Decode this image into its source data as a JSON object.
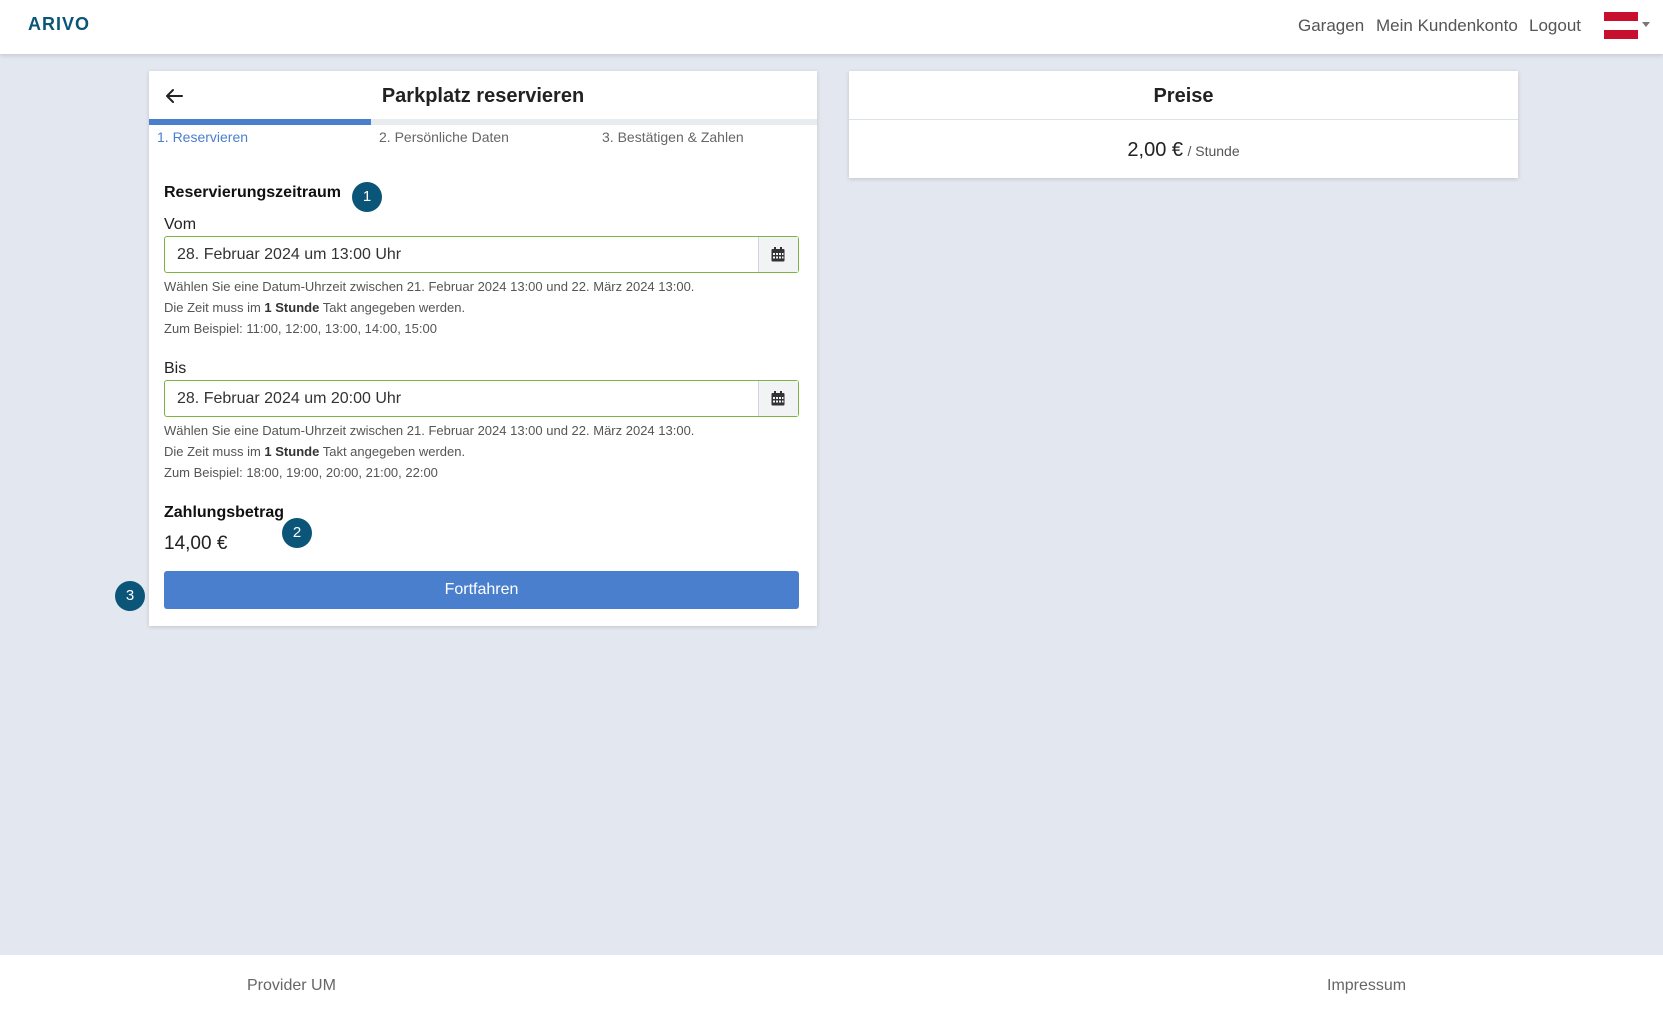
{
  "brand": "ARIVO",
  "nav": {
    "links": [
      "Garagen",
      "Mein Kundenkonto",
      "Logout"
    ]
  },
  "reservation": {
    "title": "Parkplatz reservieren",
    "steps": [
      "1. Reservieren",
      "2. Persönliche Daten",
      "3. Bestätigen & Zahlen"
    ],
    "active_step": 1,
    "period_title": "Reservierungszeitraum",
    "from": {
      "label": "Vom",
      "value": "28. Februar 2024 um 13:00 Uhr",
      "help_range": "Wählen Sie eine Datum-Uhrzeit zwischen 21. Februar 2024 13:00 und 22. März 2024 13:00.",
      "help_step_prefix": "Die Zeit muss im",
      "help_step_bold": "1 Stunde",
      "help_step_suffix": "Takt angegeben werden.",
      "help_example": "Zum Beispiel: 11:00, 12:00, 13:00, 14:00, 15:00"
    },
    "to": {
      "label": "Bis",
      "value": "28. Februar 2024 um 20:00 Uhr",
      "help_range": "Wählen Sie eine Datum-Uhrzeit zwischen 21. Februar 2024 13:00 und 22. März 2024 13:00.",
      "help_step_prefix": "Die Zeit muss im",
      "help_step_bold": "1 Stunde",
      "help_step_suffix": "Takt angegeben werden.",
      "help_example": "Zum Beispiel: 18:00, 19:00, 20:00, 21:00, 22:00"
    },
    "amount_title": "Zahlungsbetrag",
    "amount": "14,00 €",
    "continue_label": "Fortfahren"
  },
  "badges": [
    "1",
    "2",
    "3"
  ],
  "prices": {
    "title": "Preise",
    "value": "2,00 €",
    "unit": "/ Stunde"
  },
  "footer": {
    "left": "Provider UM",
    "right": "Impressum"
  },
  "colors": {
    "primary": "#4a7fce",
    "brand": "#0b5578",
    "valid_border": "#7cb342",
    "background": "#e3e7ef"
  },
  "icons": {
    "back": "arrow-left-icon",
    "calendar": "calendar-icon",
    "language": "austria-flag-icon"
  }
}
